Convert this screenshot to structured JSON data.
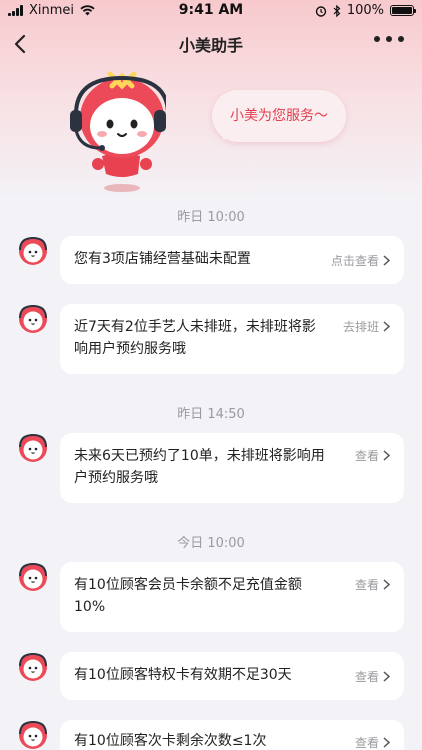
{
  "status_bar": {
    "carrier": "Xinmei",
    "time": "9:41 AM",
    "battery_percent": "100%",
    "battery_level": 1.0
  },
  "nav": {
    "title": "小美助手"
  },
  "hero": {
    "speech": "小美为您服务～"
  },
  "timeline": [
    {
      "time": "昨日 10:00",
      "messages": [
        {
          "text": "您有3项店铺经营基础未配置",
          "action": "点击查看"
        },
        {
          "text": "近7天有2位手艺人未排班，未排班将影响用户预约服务哦",
          "action": "去排班"
        }
      ]
    },
    {
      "time": "昨日 14:50",
      "messages": [
        {
          "text": "未来6天已预约了10单，未排班将影响用户预约服务哦",
          "action": "查看"
        }
      ]
    },
    {
      "time": "今日 10:00",
      "messages": [
        {
          "text": "有10位顾客会员卡余额不足充值金额10%",
          "action": "查看"
        },
        {
          "text": "有10位顾客特权卡有效期不足30天",
          "action": "查看"
        },
        {
          "text": "有10位顾客次卡剩余次数≤1次",
          "action": "查看"
        }
      ]
    }
  ],
  "colors": {
    "accent": "#e2404f",
    "bg": "#f3f2f6",
    "hero_top": "#f7c9cd"
  }
}
